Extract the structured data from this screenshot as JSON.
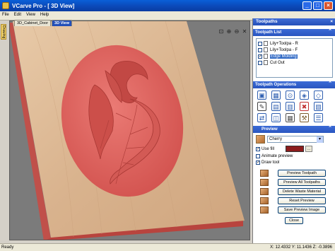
{
  "window": {
    "title": "VCarve Pro - [ 3D View]",
    "minimize": "_",
    "maximize": "□",
    "close": "×"
  },
  "menu": [
    "File",
    "Edit",
    "View",
    "Help"
  ],
  "left_tab": {
    "label": "Drawing"
  },
  "document_tabs": [
    {
      "label": "3D_Cabinet_Door",
      "active": false
    },
    {
      "label": "3D View",
      "active": true
    }
  ],
  "view_tools": {
    "fit": "⊡",
    "zoom_in": "⊕",
    "zoom_out": "⊖",
    "close": "✕"
  },
  "toolpaths_panel": {
    "title": "Toolpaths",
    "close": "×",
    "list_heading": "Toolpath List",
    "toolpaths": [
      {
        "label": "Lily+Toolpa - R",
        "checked": false,
        "selected": false
      },
      {
        "label": "Lily+Toolpa - F",
        "checked": false,
        "selected": false
      },
      {
        "label": "Edge Molding",
        "checked": true,
        "selected": true
      },
      {
        "label": "Cut Out",
        "checked": false,
        "selected": false
      }
    ],
    "operations_heading": "Toolpath Operations",
    "operations": [
      {
        "name": "profile-toolpath-icon",
        "glyph": "▣",
        "color": "#2f5fb0"
      },
      {
        "name": "pocket-toolpath-icon",
        "glyph": "▦",
        "color": "#2f5fb0"
      },
      {
        "name": "drill-toolpath-icon",
        "glyph": "⊙",
        "color": "#2f5fb0"
      },
      {
        "name": "inlay-toolpath-icon",
        "glyph": "◈",
        "color": "#2f5fb0"
      },
      {
        "name": "vcarve-toolpath-icon",
        "glyph": "◇",
        "color": "#2f5fb0"
      },
      {
        "name": "edit-toolpath-icon",
        "glyph": "✎",
        "color": "#404040"
      },
      {
        "name": "rough-toolpath-icon",
        "glyph": "▤",
        "color": "#2f5fb0"
      },
      {
        "name": "finish-toolpath-icon",
        "glyph": "▥",
        "color": "#2f5fb0"
      },
      {
        "name": "delete-toolpath-icon",
        "glyph": "✖",
        "color": "#c03030"
      },
      {
        "name": "save-toolpath-icon",
        "glyph": "▧",
        "color": "#2f5fb0"
      },
      {
        "name": "merge-toolpath-icon",
        "glyph": "⇄",
        "color": "#2f5fb0"
      },
      {
        "name": "template-toolpath-icon",
        "glyph": "◫",
        "color": "#2f5fb0"
      },
      {
        "name": "calculator-icon",
        "glyph": "▦",
        "color": "#505050"
      },
      {
        "name": "tool-database-icon",
        "glyph": "⚒",
        "color": "#7a5a2a"
      },
      {
        "name": "toolpath-summary-icon",
        "glyph": "☰",
        "color": "#2f5fb0"
      }
    ],
    "preview": {
      "heading": "Preview",
      "material": "Cherry",
      "use_fill_label": "Use fill",
      "use_fill": true,
      "animate_label": "Animate preview",
      "animate": false,
      "draw_tool_label": "Draw tool",
      "draw_tool": true,
      "fill_color": "#8c1c1c",
      "buttons": {
        "preview_toolpath": "Preview Toolpath",
        "preview_all": "Preview All Toolpaths",
        "delete_waste": "Delete Waste Material",
        "reset_preview": "Reset Preview",
        "save_preview": "Save Preview Image",
        "close": "Close"
      }
    }
  },
  "status": {
    "left": "Ready",
    "coords": "X: 12.4332 Y: 11.1436 Z: -0.3896"
  },
  "colors": {
    "titlebar": "#0b47b5",
    "carving": "#e06a66",
    "wood": "#dcb896"
  }
}
